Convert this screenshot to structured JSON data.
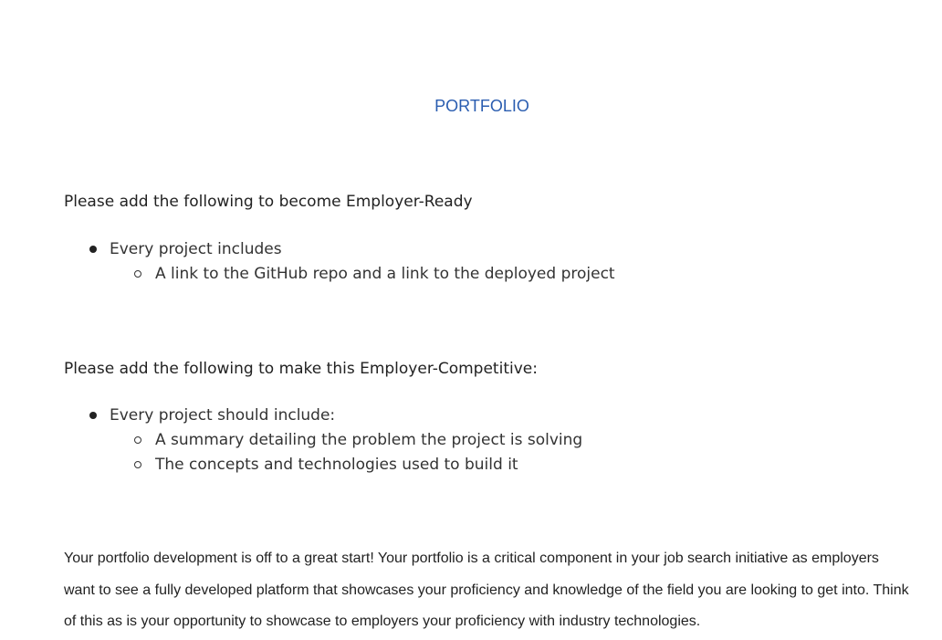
{
  "page": {
    "title": "PORTFOLIO"
  },
  "employer_ready": {
    "heading": "Please add the following to become Employer-Ready",
    "items": [
      {
        "label": "Every project includes",
        "subitems": [
          "A link to the GitHub repo and a link to the deployed project"
        ]
      }
    ]
  },
  "employer_competitive": {
    "heading": "Please add the following to make this Employer-Competitive:",
    "items": [
      {
        "label": "Every project should include:",
        "subitems": [
          "A summary detailing the problem the project is solving",
          "The concepts and technologies used to build it"
        ]
      }
    ]
  },
  "summary": {
    "text": "Your portfolio development is off to a great start! Your portfolio is a critical component in your job search initiative as employers want to see a fully developed platform that showcases your proficiency and knowledge of the field you are looking to get into. Think of this as is your opportunity to showcase to employers your proficiency with industry technologies."
  }
}
